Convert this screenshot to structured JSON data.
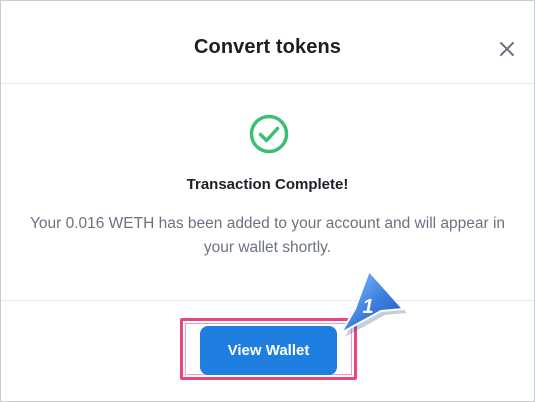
{
  "modal": {
    "title": "Convert tokens",
    "close_icon": "close-icon"
  },
  "status": {
    "icon": "check-circle-icon",
    "heading": "Transaction Complete!",
    "message": "Your 0.016 WETH has been added to your account and will appear in your wallet shortly."
  },
  "actions": {
    "view_wallet_label": "View Wallet"
  },
  "annotation": {
    "step_number": "1"
  },
  "colors": {
    "success_green": "#3cbf75",
    "primary_blue": "#1f7fe0",
    "highlight_pink": "#e8467f",
    "callout_blue": "#3b7ddd"
  }
}
